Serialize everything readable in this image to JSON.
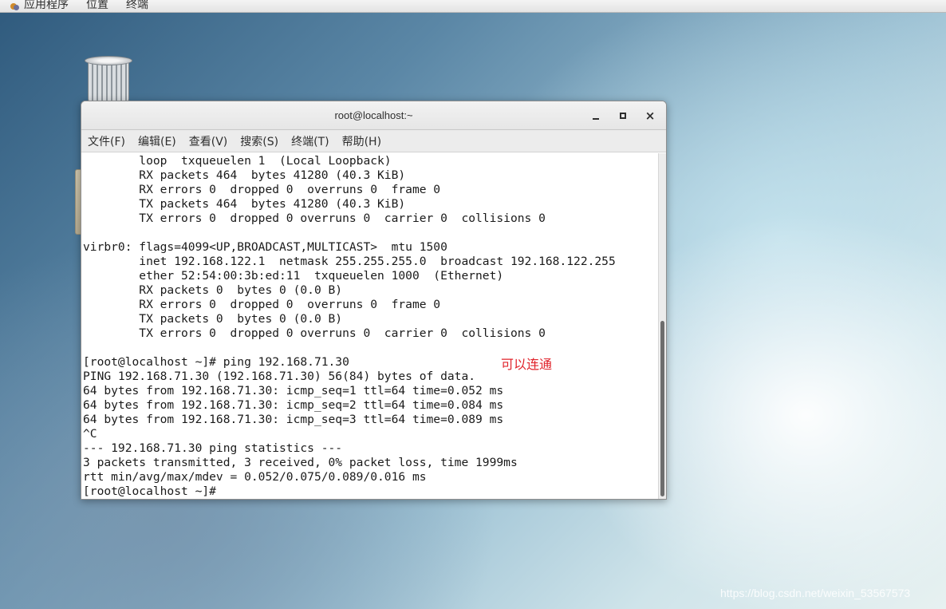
{
  "top_panel": {
    "items": [
      "应用程序",
      "位置",
      "终端"
    ]
  },
  "window": {
    "title": "root@localhost:~",
    "controls": {
      "minimize": "minimize",
      "maximize": "maximize",
      "close": "×"
    },
    "menu": [
      "文件(F)",
      "编辑(E)",
      "查看(V)",
      "搜索(S)",
      "终端(T)",
      "帮助(H)"
    ]
  },
  "terminal": {
    "lines": [
      "        loop  txqueuelen 1  (Local Loopback)",
      "        RX packets 464  bytes 41280 (40.3 KiB)",
      "        RX errors 0  dropped 0  overruns 0  frame 0",
      "        TX packets 464  bytes 41280 (40.3 KiB)",
      "        TX errors 0  dropped 0 overruns 0  carrier 0  collisions 0",
      "",
      "virbr0: flags=4099<UP,BROADCAST,MULTICAST>  mtu 1500",
      "        inet 192.168.122.1  netmask 255.255.255.0  broadcast 192.168.122.255",
      "        ether 52:54:00:3b:ed:11  txqueuelen 1000  (Ethernet)",
      "        RX packets 0  bytes 0 (0.0 B)",
      "        RX errors 0  dropped 0  overruns 0  frame 0",
      "        TX packets 0  bytes 0 (0.0 B)",
      "        TX errors 0  dropped 0 overruns 0  carrier 0  collisions 0",
      "",
      "[root@localhost ~]# ping 192.168.71.30",
      "PING 192.168.71.30 (192.168.71.30) 56(84) bytes of data.",
      "64 bytes from 192.168.71.30: icmp_seq=1 ttl=64 time=0.052 ms",
      "64 bytes from 192.168.71.30: icmp_seq=2 ttl=64 time=0.084 ms",
      "64 bytes from 192.168.71.30: icmp_seq=3 ttl=64 time=0.089 ms",
      "^C",
      "--- 192.168.71.30 ping statistics ---",
      "3 packets transmitted, 3 received, 0% packet loss, time 1999ms",
      "rtt min/avg/max/mdev = 0.052/0.075/0.089/0.016 ms",
      "[root@localhost ~]# "
    ],
    "annotation": "可以连通"
  },
  "watermark": "https://blog.csdn.net/weixin_53567573",
  "colors": {
    "annotation": "#e0232b",
    "terminal_bg": "#ffffff",
    "terminal_text": "#1a1a1a"
  }
}
